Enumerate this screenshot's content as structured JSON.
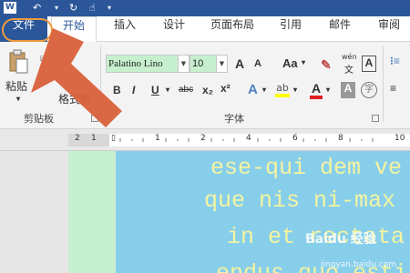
{
  "titlebar": {
    "app_icon": "W"
  },
  "tabs": [
    {
      "label": "文件"
    },
    {
      "label": "开始"
    },
    {
      "label": "插入"
    },
    {
      "label": "设计"
    },
    {
      "label": "页面布局"
    },
    {
      "label": "引用"
    },
    {
      "label": "邮件"
    },
    {
      "label": "审阅"
    }
  ],
  "clipboard": {
    "paste_label": "粘贴",
    "format_painter_label": "格式刷",
    "group_label": "剪贴板"
  },
  "font": {
    "font_name": "Palatino Lino",
    "font_size": "10",
    "group_label": "字体",
    "grow_label": "A",
    "shrink_label": "A",
    "case_label": "Aa",
    "wen_label": "wén",
    "wen_sub": "文",
    "border_a_label": "A",
    "bold": "B",
    "italic": "I",
    "underline": "U",
    "strike": "abc",
    "sub": "x₂",
    "sup": "x²",
    "effect_label": "A",
    "highlight_label": "ab",
    "color_label": "A",
    "shade_label": "A",
    "enclose_label": "字"
  },
  "ruler": {
    "numbers": [
      "2",
      "1",
      "1",
      "2",
      "4",
      "6",
      "8",
      "10"
    ]
  },
  "document": {
    "lines": [
      "ese-qui dem ve",
      "que nis ni-max",
      "in et rectata",
      "endus quo esti"
    ]
  },
  "watermark": {
    "brand": "Baidu 经验",
    "url": "jingyan.baidu.com"
  },
  "colors": {
    "word_blue": "#2b579a",
    "arrow": "#d9603a",
    "highlight_ring": "#ed9a3c",
    "page": "#87ceeb",
    "margin": "#c6efce",
    "text": "#f4f4a0"
  }
}
